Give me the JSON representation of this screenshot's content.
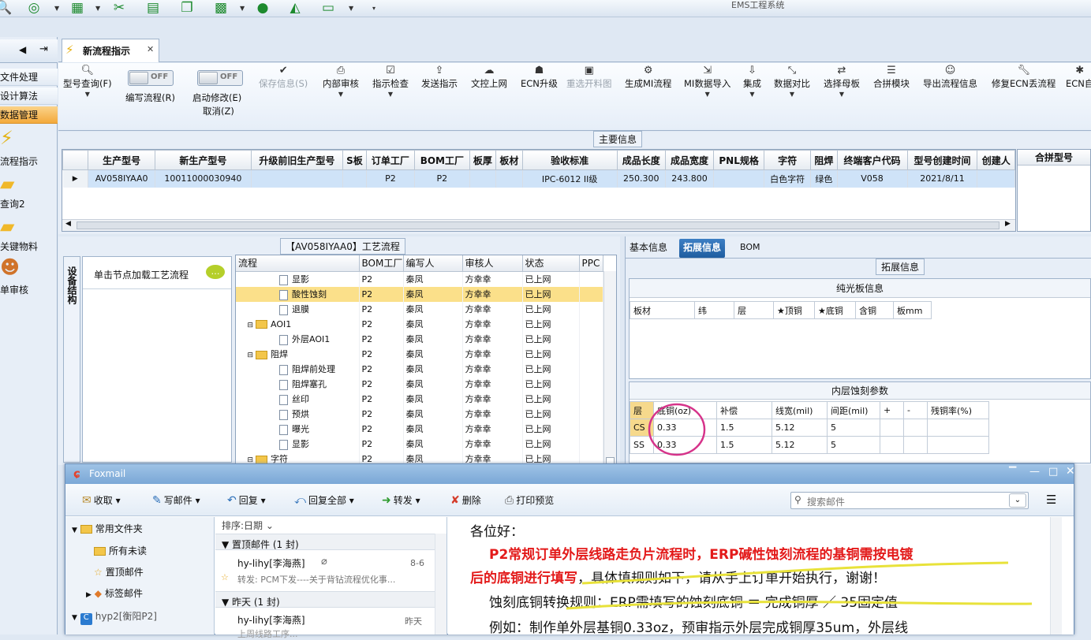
{
  "app": {
    "title": "EMS工程系统"
  },
  "nav": {
    "items": [
      "文件处理",
      "设计算法",
      "数据管理"
    ],
    "shortcuts": [
      "流程指示",
      "查询2",
      "关键物料",
      "单审核"
    ]
  },
  "tab": {
    "label": "新流程指示"
  },
  "ribbon": {
    "items": [
      {
        "label": "型号查询(F)",
        "icon": "search-icon"
      },
      {
        "label": "编写流程(R)",
        "toggle": "OFF"
      },
      {
        "label": "启动修改(E)",
        "toggle": "OFF",
        "sub": "取消(Z)"
      },
      {
        "label": "保存信息(S)",
        "icon": "check-icon",
        "disabled": true
      },
      {
        "label": "内部审核",
        "icon": "print-icon"
      },
      {
        "label": "指示检查",
        "icon": "checkbox-icon"
      },
      {
        "label": "发送指示",
        "icon": "upload-icon"
      },
      {
        "label": "文控上网",
        "icon": "cloud-icon"
      },
      {
        "label": "ECN升级",
        "icon": "people-icon"
      },
      {
        "label": "重选开料图",
        "icon": "image-icon",
        "disabled": true
      },
      {
        "label": "生成MI流程",
        "icon": "gears-icon"
      },
      {
        "label": "MI数据导入",
        "icon": "import-icon"
      },
      {
        "label": "集成",
        "icon": "download-icon"
      },
      {
        "label": "数据对比",
        "icon": "compare-icon"
      },
      {
        "label": "选择母板",
        "icon": "shuffle-icon"
      },
      {
        "label": "合拼模块",
        "icon": "list-icon"
      },
      {
        "label": "导出流程信息",
        "icon": "smile-icon"
      },
      {
        "label": "修复ECN丢流程",
        "icon": "wrench-icon"
      },
      {
        "label": "ECN自",
        "icon": "star-icon"
      }
    ]
  },
  "main_info": {
    "legend": "主要信息",
    "columns": [
      "生产型号",
      "新生产型号",
      "升级前旧生产型号",
      "S板",
      "订单工厂",
      "BOM工厂",
      "板厚",
      "板材",
      "验收标准",
      "成品长度",
      "成品宽度",
      "PNL规格",
      "字符",
      "阻焊",
      "终端客户代码",
      "型号创建时间",
      "创建人"
    ],
    "row": [
      "AV058IYAA0",
      "10011000030940",
      "",
      "",
      "P2",
      "P2",
      "",
      "",
      "IPC-6012 II级",
      "250.300",
      "243.800",
      "",
      "白色字符",
      "绿色",
      "V058",
      "2021/8/11",
      ""
    ],
    "merge_label": "合拼型号"
  },
  "process": {
    "legend": "【AV058IYAA0】工艺流程",
    "side_tab": "设备结构",
    "hint": "单击节点加载工艺流程",
    "columns": [
      "流程",
      "BOM工厂",
      "编写人",
      "审核人",
      "状态",
      "PPC"
    ],
    "rows": [
      {
        "name": "显影",
        "level": 2,
        "bom": "P2",
        "writer": "秦凤",
        "reviewer": "方幸幸",
        "status": "已上网"
      },
      {
        "name": "酸性蚀刻",
        "level": 2,
        "bom": "P2",
        "writer": "秦凤",
        "reviewer": "方幸幸",
        "status": "已上网",
        "selected": true
      },
      {
        "name": "退膜",
        "level": 2,
        "bom": "P2",
        "writer": "秦凤",
        "reviewer": "方幸幸",
        "status": "已上网"
      },
      {
        "name": "AOI1",
        "level": 1,
        "bom": "P2",
        "writer": "秦凤",
        "reviewer": "方幸幸",
        "status": "已上网"
      },
      {
        "name": "外层AOI1",
        "level": 2,
        "bom": "P2",
        "writer": "秦凤",
        "reviewer": "方幸幸",
        "status": "已上网"
      },
      {
        "name": "阻焊",
        "level": 1,
        "bom": "P2",
        "writer": "秦凤",
        "reviewer": "方幸幸",
        "status": "已上网"
      },
      {
        "name": "阻焊前处理",
        "level": 2,
        "bom": "P2",
        "writer": "秦凤",
        "reviewer": "方幸幸",
        "status": "已上网"
      },
      {
        "name": "阻焊塞孔",
        "level": 2,
        "bom": "P2",
        "writer": "秦凤",
        "reviewer": "方幸幸",
        "status": "已上网"
      },
      {
        "name": "丝印",
        "level": 2,
        "bom": "P2",
        "writer": "秦凤",
        "reviewer": "方幸幸",
        "status": "已上网"
      },
      {
        "name": "预烘",
        "level": 2,
        "bom": "P2",
        "writer": "秦凤",
        "reviewer": "方幸幸",
        "status": "已上网"
      },
      {
        "name": "曝光",
        "level": 2,
        "bom": "P2",
        "writer": "秦凤",
        "reviewer": "方幸幸",
        "status": "已上网"
      },
      {
        "name": "显影",
        "level": 2,
        "bom": "P2",
        "writer": "秦凤",
        "reviewer": "方幸幸",
        "status": "已上网"
      },
      {
        "name": "字符",
        "level": 1,
        "bom": "P2",
        "writer": "秦凤",
        "reviewer": "方幸幸",
        "status": "已上网"
      }
    ]
  },
  "ext": {
    "tabs": [
      "基本信息",
      "拓展信息",
      "BOM"
    ],
    "legend": "拓展信息",
    "panel1_title": "纯光板信息",
    "panel1_cols": [
      "板材",
      "纬",
      "层",
      "★顶铜",
      "★底铜",
      "含铜",
      "板mm"
    ],
    "panel2_title": "内层蚀刻参数",
    "panel2_cols": [
      "层",
      "底铜(oz)",
      "补偿",
      "线宽(mil)",
      "间距(mil)",
      "+",
      "-",
      "残铜率(%)"
    ],
    "panel2_rows": [
      [
        "CS",
        "0.33",
        "1.5",
        "5.12",
        "5",
        "",
        "",
        ""
      ],
      [
        "SS",
        "0.33",
        "1.5",
        "5.12",
        "5",
        "",
        "",
        ""
      ]
    ]
  },
  "foxmail": {
    "title": "Foxmail",
    "toolbar": [
      "收取",
      "写邮件",
      "回复",
      "回复全部",
      "转发",
      "删除",
      "打印预览"
    ],
    "search_placeholder": "搜索邮件",
    "folders": [
      "常用文件夹",
      "所有未读",
      "置顶邮件",
      "标签邮件",
      "hyp2[衡阳P2]"
    ],
    "sort_label": "排序:日期",
    "groups": [
      {
        "label": "置顶邮件 (1 封)",
        "sender": "hy-lihy[李海燕]",
        "date": "8-6",
        "preview": "转发: PCM下发----关于背钻流程优化事..."
      },
      {
        "label": "昨天 (1 封)",
        "sender": "hy-lihy[李海燕]",
        "date": "昨天",
        "preview": "上周线路工序..."
      }
    ],
    "body": {
      "greeting": "各位好：",
      "line1": "P2常规订单外层线路走负片流程时，ERP碱性蚀刻流程的基铜需按电镀",
      "line2_red": "后的底铜进行填写",
      "line2_rest": "，具体填规则如下，请从手上订单开始执行，谢谢！",
      "line3": "蚀刻底铜转换规则：ERP需填写的蚀刻底铜 ＝ 完成铜厚 ／ 35固定值",
      "line4": "例如：制作单外层基铜0.33oz，预审指示外层完成铜厚35um，外层线"
    }
  }
}
